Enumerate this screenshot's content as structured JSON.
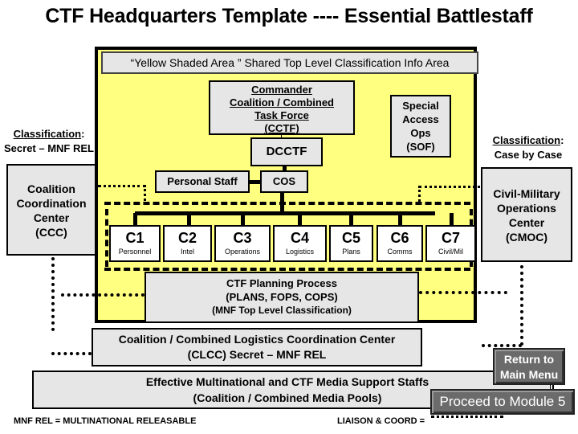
{
  "title": "CTF Headquarters Template ---- Essential Battlestaff",
  "banner": "“Yellow Shaded Area ” Shared Top Level Classification Info Area",
  "commander": {
    "lines": [
      "Commander",
      "Coalition / Combined",
      "Task Force",
      "(CCTF)"
    ]
  },
  "dcctf": "DCCTF",
  "sof": {
    "lines": [
      "Special",
      "Access",
      "Ops",
      "(SOF)"
    ]
  },
  "personal_staff": "Personal Staff",
  "cos": "COS",
  "staff_sections": [
    {
      "code": "C1",
      "name": "Personnel"
    },
    {
      "code": "C2",
      "name": "Intel"
    },
    {
      "code": "C3",
      "name": "Operations"
    },
    {
      "code": "C4",
      "name": "Logistics"
    },
    {
      "code": "C5",
      "name": "Plans"
    },
    {
      "code": "C6",
      "name": "Comms"
    },
    {
      "code": "C7",
      "name": "Civil/Mil"
    }
  ],
  "planning": {
    "line1": "CTF Planning Process",
    "line2": "(PLANS, FOPS, COPS)",
    "line3": "(MNF Top Level Classification)"
  },
  "clcc": {
    "line1": "Coalition / Combined Logistics Coordination Center",
    "line2": "(CLCC) Secret – MNF REL"
  },
  "media": {
    "line1": "Effective Multinational and CTF Media Support Staffs",
    "line2": "(Coalition / Combined Media Pools)"
  },
  "left_classification": {
    "label": "Classification",
    "value": "Secret – MNF REL"
  },
  "right_classification": {
    "label": "Classification",
    "value": "Case by Case"
  },
  "ccc": {
    "lines": [
      "Coalition",
      "Coordination",
      "Center",
      "(CCC)"
    ]
  },
  "cmoc": {
    "lines": [
      "Civil-Military",
      "Operations",
      "Center",
      "(CMOC)"
    ]
  },
  "buttons": {
    "return_main_menu": {
      "line1": "Return to",
      "line2": "Main Menu"
    },
    "proceed": "Proceed to Module 5"
  },
  "legend": {
    "mnf_rel": "MNF REL = MULTINATIONAL RELEASABLE",
    "liaison": "LIAISON & COORD ="
  },
  "colors": {
    "shared_area": "#ffff80",
    "box_fill": "#e6e6e6",
    "button_fill": "#6b6b6b"
  }
}
